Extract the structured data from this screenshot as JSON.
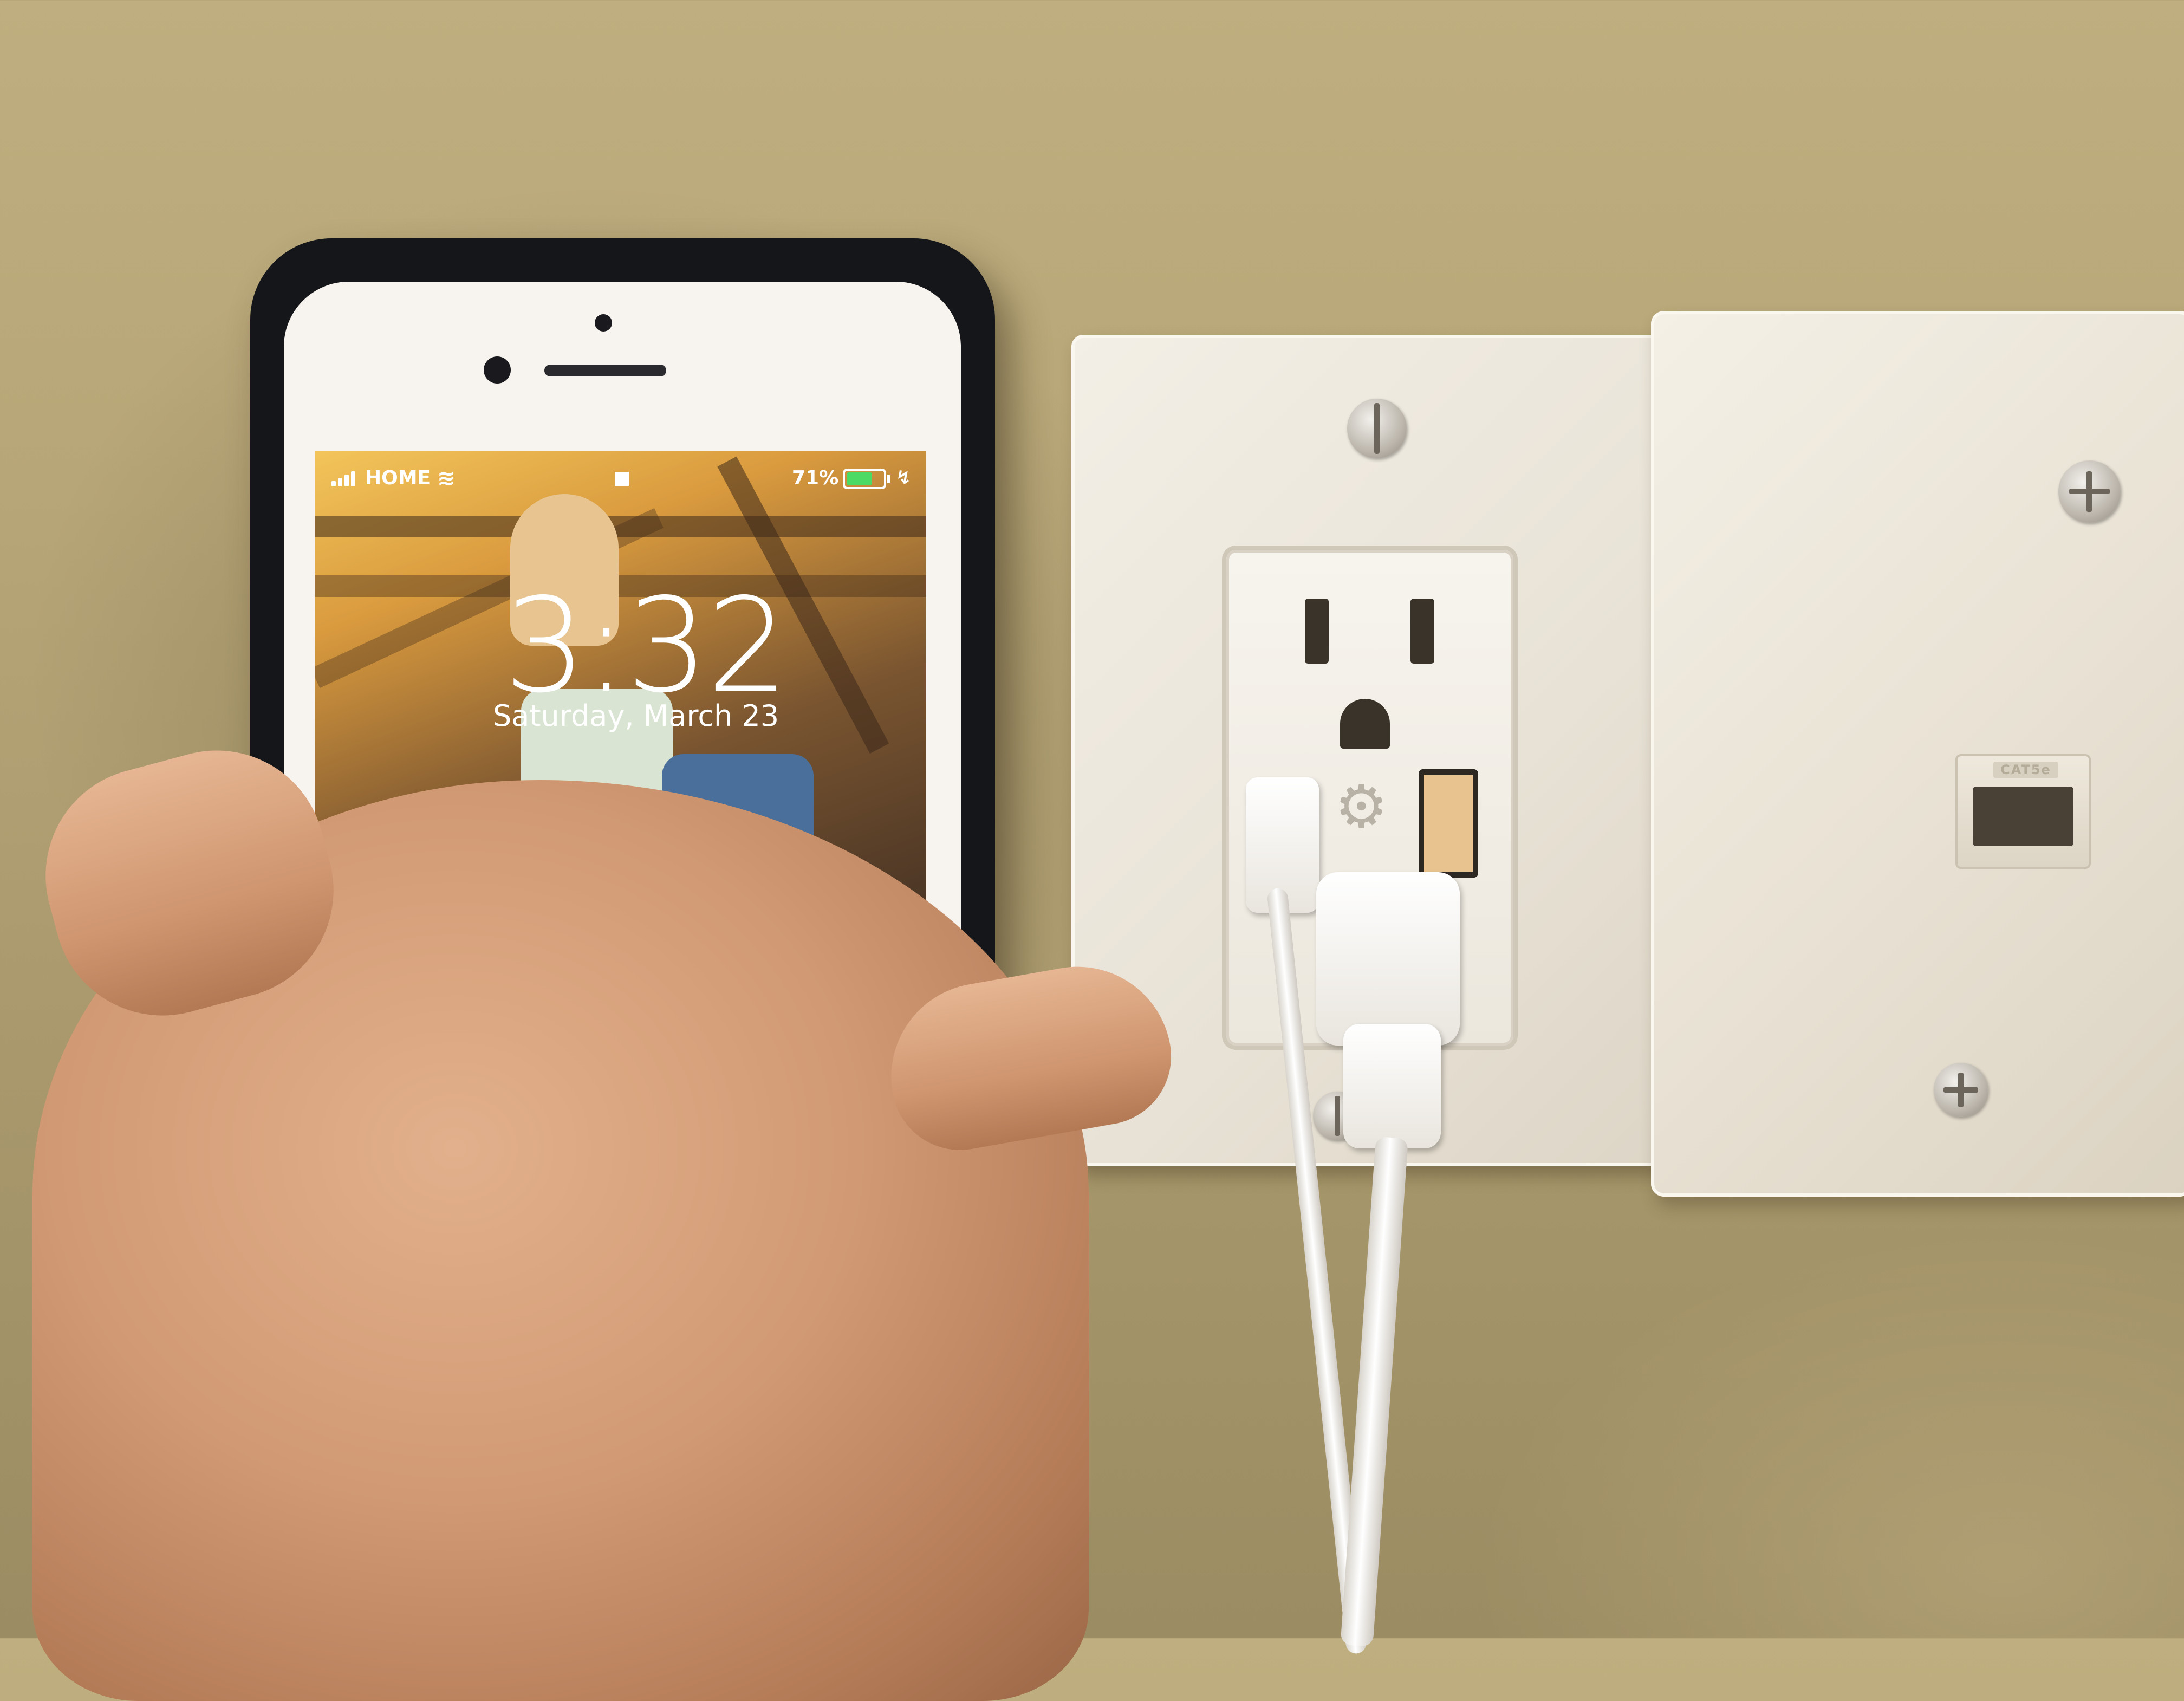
{
  "phone": {
    "carrier": "HOME",
    "battery_percent": "71%",
    "battery_level": 0.71,
    "time": "3:32",
    "date": "Saturday, March 23"
  },
  "jack": {
    "label": "CAT5e"
  },
  "colors": {
    "wall": "#b7a677",
    "plate": "#efeae0",
    "phone_case": "#15161a",
    "battery_green": "#4cd964",
    "skin": "#d19a74"
  }
}
